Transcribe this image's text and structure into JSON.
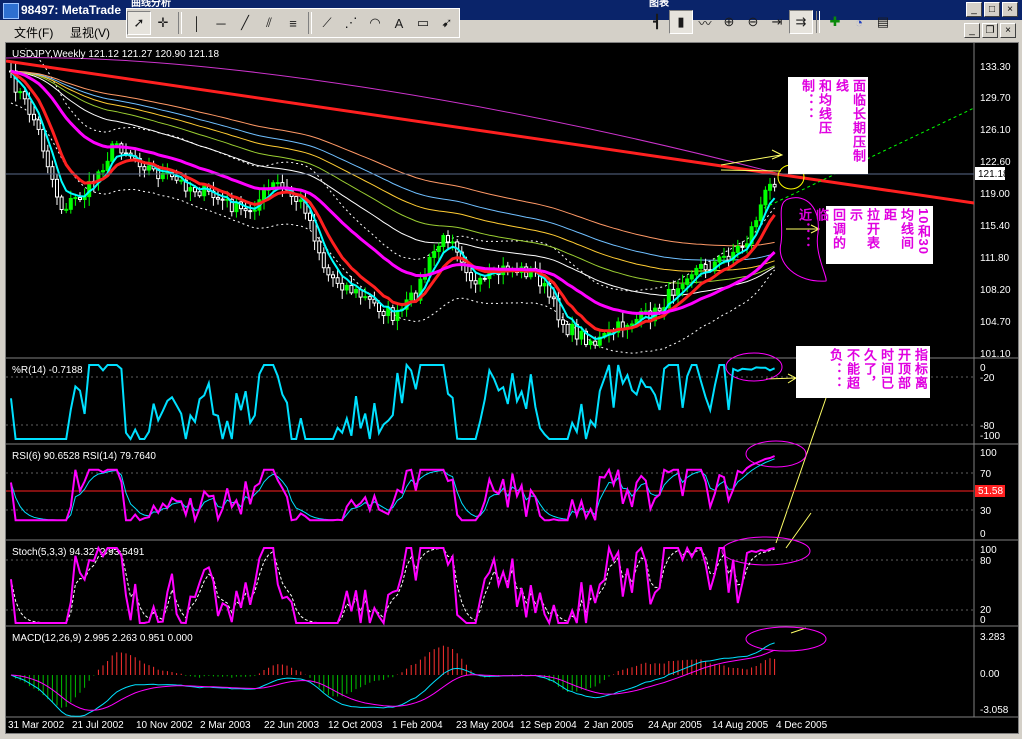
{
  "window": {
    "title": "98497: MetaTrade",
    "float_titles": [
      "曲线分析",
      "图表"
    ],
    "controls": [
      "minimize",
      "maximize",
      "close"
    ]
  },
  "menu": {
    "items": [
      "文件(F)",
      "显视(V)"
    ]
  },
  "toolbar": {
    "tools": [
      "cursor-icon",
      "crosshair-icon",
      "vertical-line-icon",
      "horizontal-line-icon",
      "trendline-icon",
      "channel-icon",
      "fibonacci-icon",
      "gann-icon",
      "fibo-fan-icon",
      "fibo-arcs-icon",
      "text-icon",
      "label-icon",
      "arrow-icon"
    ],
    "chart_tools": [
      "bar-chart-icon",
      "candle-icon",
      "line-chart-icon",
      "zoom-in-icon",
      "zoom-out-icon",
      "chart-shift-icon",
      "autoscroll-icon",
      "indicators-icon",
      "periods-icon",
      "templates-icon"
    ]
  },
  "chart": {
    "symbol_label": "USDJPY,Weekly  121.12 121.27 120.90 121.18",
    "current_price": "121.18",
    "price_axis": [
      "133.30",
      "129.70",
      "126.10",
      "122.60",
      "119.00",
      "115.40",
      "111.80",
      "108.20",
      "104.70",
      "101.10"
    ],
    "date_axis": [
      "31 Mar 2002",
      "21 Jul 2002",
      "10 Nov 2002",
      "2 Mar 2003",
      "22 Jun 2003",
      "12 Oct 2003",
      "1 Feb 2004",
      "23 May 2004",
      "12 Sep 2004",
      "2 Jan 2005",
      "24 Apr 2005",
      "14 Aug 2005",
      "4 Dec 2005"
    ],
    "colors": {
      "background": "#000000",
      "bull": "#00ff00",
      "bear": "#ffffff",
      "trendline": "#ff2020",
      "ma_fast": "#00ffff",
      "ma_mid": "#ff2020",
      "ma_slow": "#ff00ff",
      "annotation": "#ff00ff"
    }
  },
  "wpr": {
    "label": "%R(14) -0.7188",
    "axis": [
      "0",
      "-20",
      "-80",
      "-100"
    ],
    "color": "#00e0ff"
  },
  "rsi": {
    "label": "RSI(6) 90.6528  RSI(14) 79.7640",
    "axis": [
      "100",
      "70",
      "30",
      "0"
    ],
    "level_badge": "51.58",
    "color": "#ff00ff"
  },
  "stoch": {
    "label": "Stoch(5,3,3) 94.3272 93.5491",
    "axis": [
      "100",
      "80",
      "20",
      "0"
    ],
    "color": "#ff00ff"
  },
  "macd": {
    "label": "MACD(12,26,9) 2.995 2.263 0.951 0.000",
    "axis": [
      "3.283",
      "0.00",
      "-3.058"
    ]
  },
  "notes": {
    "main_top": [
      "面临长期压制线",
      "和均线压制：："
    ],
    "main_mid": [
      "10和30",
      "均线间距",
      "拉开表示",
      "回调的临",
      "近：："
    ],
    "wpr_note": [
      "指标离",
      "开顶部",
      "时间已",
      "久了，",
      "不能超",
      "负：："
    ]
  }
}
